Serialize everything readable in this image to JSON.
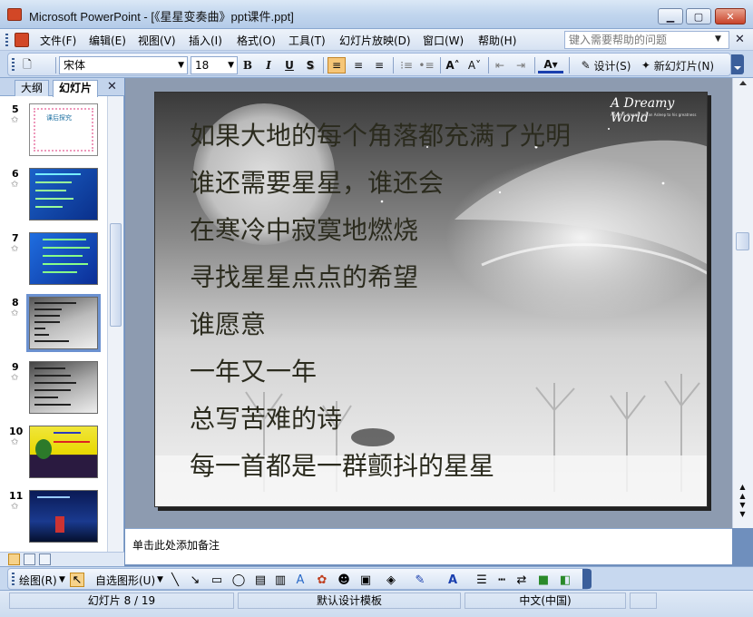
{
  "window": {
    "title": "Microsoft PowerPoint - [《星星变奏曲》ppt课件.ppt]",
    "min_label": "▁",
    "max_label": "▢",
    "close_label": "✕"
  },
  "menu": {
    "items": [
      "文件(F)",
      "编辑(E)",
      "视图(V)",
      "插入(I)",
      "格式(O)",
      "工具(T)",
      "幻灯片放映(D)",
      "窗口(W)",
      "帮助(H)"
    ],
    "help_placeholder": "键入需要帮助的问题"
  },
  "toolbar": {
    "font_name": "宋体",
    "font_size": "18",
    "bold": "B",
    "italic": "I",
    "underline": "U",
    "shadow": "S",
    "design_label": "设计(S)",
    "new_slide_label": "新幻灯片(N)"
  },
  "panel": {
    "tabs": [
      "大纲",
      "幻灯片"
    ],
    "active_tab": 1,
    "close_label": "✕",
    "thumbnails": [
      {
        "number": "5",
        "title": "课后探究",
        "selected": false
      },
      {
        "number": "6",
        "selected": false
      },
      {
        "number": "7",
        "selected": false
      },
      {
        "number": "8",
        "selected": true
      },
      {
        "number": "9",
        "selected": false
      },
      {
        "number": "10",
        "selected": false
      },
      {
        "number": "11",
        "selected": false
      }
    ]
  },
  "slide": {
    "logo": "A Dreamy World",
    "logo_sub": "A poet's dreams are an Asleep to his greatness",
    "lines": [
      "如果大地的每个角落都充满了光明",
      "谁还需要星星，谁还会",
      "在寒冷中寂寞地燃烧",
      "寻找星星点点的希望",
      "谁愿意",
      "一年又一年",
      "总写苦难的诗",
      "每一首都是一群颤抖的星星"
    ]
  },
  "notes": {
    "placeholder": "单击此处添加备注"
  },
  "draw_toolbar": {
    "draw_label": "绘图(R)",
    "autoshapes_label": "自选图形(U)"
  },
  "status": {
    "slide_position": "幻灯片 8 / 19",
    "template": "默认设计模板",
    "language": "中文(中国)"
  },
  "colors": {
    "accent": "#3b5f9b",
    "selection": "#6b91d0"
  }
}
